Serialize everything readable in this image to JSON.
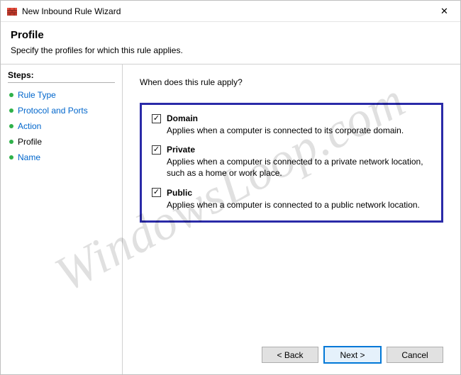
{
  "titlebar": {
    "icon_name": "firewall-icon",
    "title": "New Inbound Rule Wizard",
    "close_glyph": "✕"
  },
  "header": {
    "title": "Profile",
    "subtitle": "Specify the profiles for which this rule applies."
  },
  "steps": {
    "title": "Steps:",
    "items": [
      {
        "label": "Rule Type",
        "current": false
      },
      {
        "label": "Protocol and Ports",
        "current": false
      },
      {
        "label": "Action",
        "current": false
      },
      {
        "label": "Profile",
        "current": true
      },
      {
        "label": "Name",
        "current": false
      }
    ]
  },
  "content": {
    "question": "When does this rule apply?",
    "profiles": [
      {
        "key": "domain",
        "label": "Domain",
        "checked": true,
        "desc": "Applies when a computer is connected to its corporate domain."
      },
      {
        "key": "private",
        "label": "Private",
        "checked": true,
        "desc": "Applies when a computer is connected to a private network location, such as a home or work place."
      },
      {
        "key": "public",
        "label": "Public",
        "checked": true,
        "desc": "Applies when a computer is connected to a public network location."
      }
    ]
  },
  "buttons": {
    "back": "< Back",
    "next": "Next >",
    "cancel": "Cancel"
  },
  "watermark": "WindowsLoop.com",
  "checkbox_glyph": "✓"
}
